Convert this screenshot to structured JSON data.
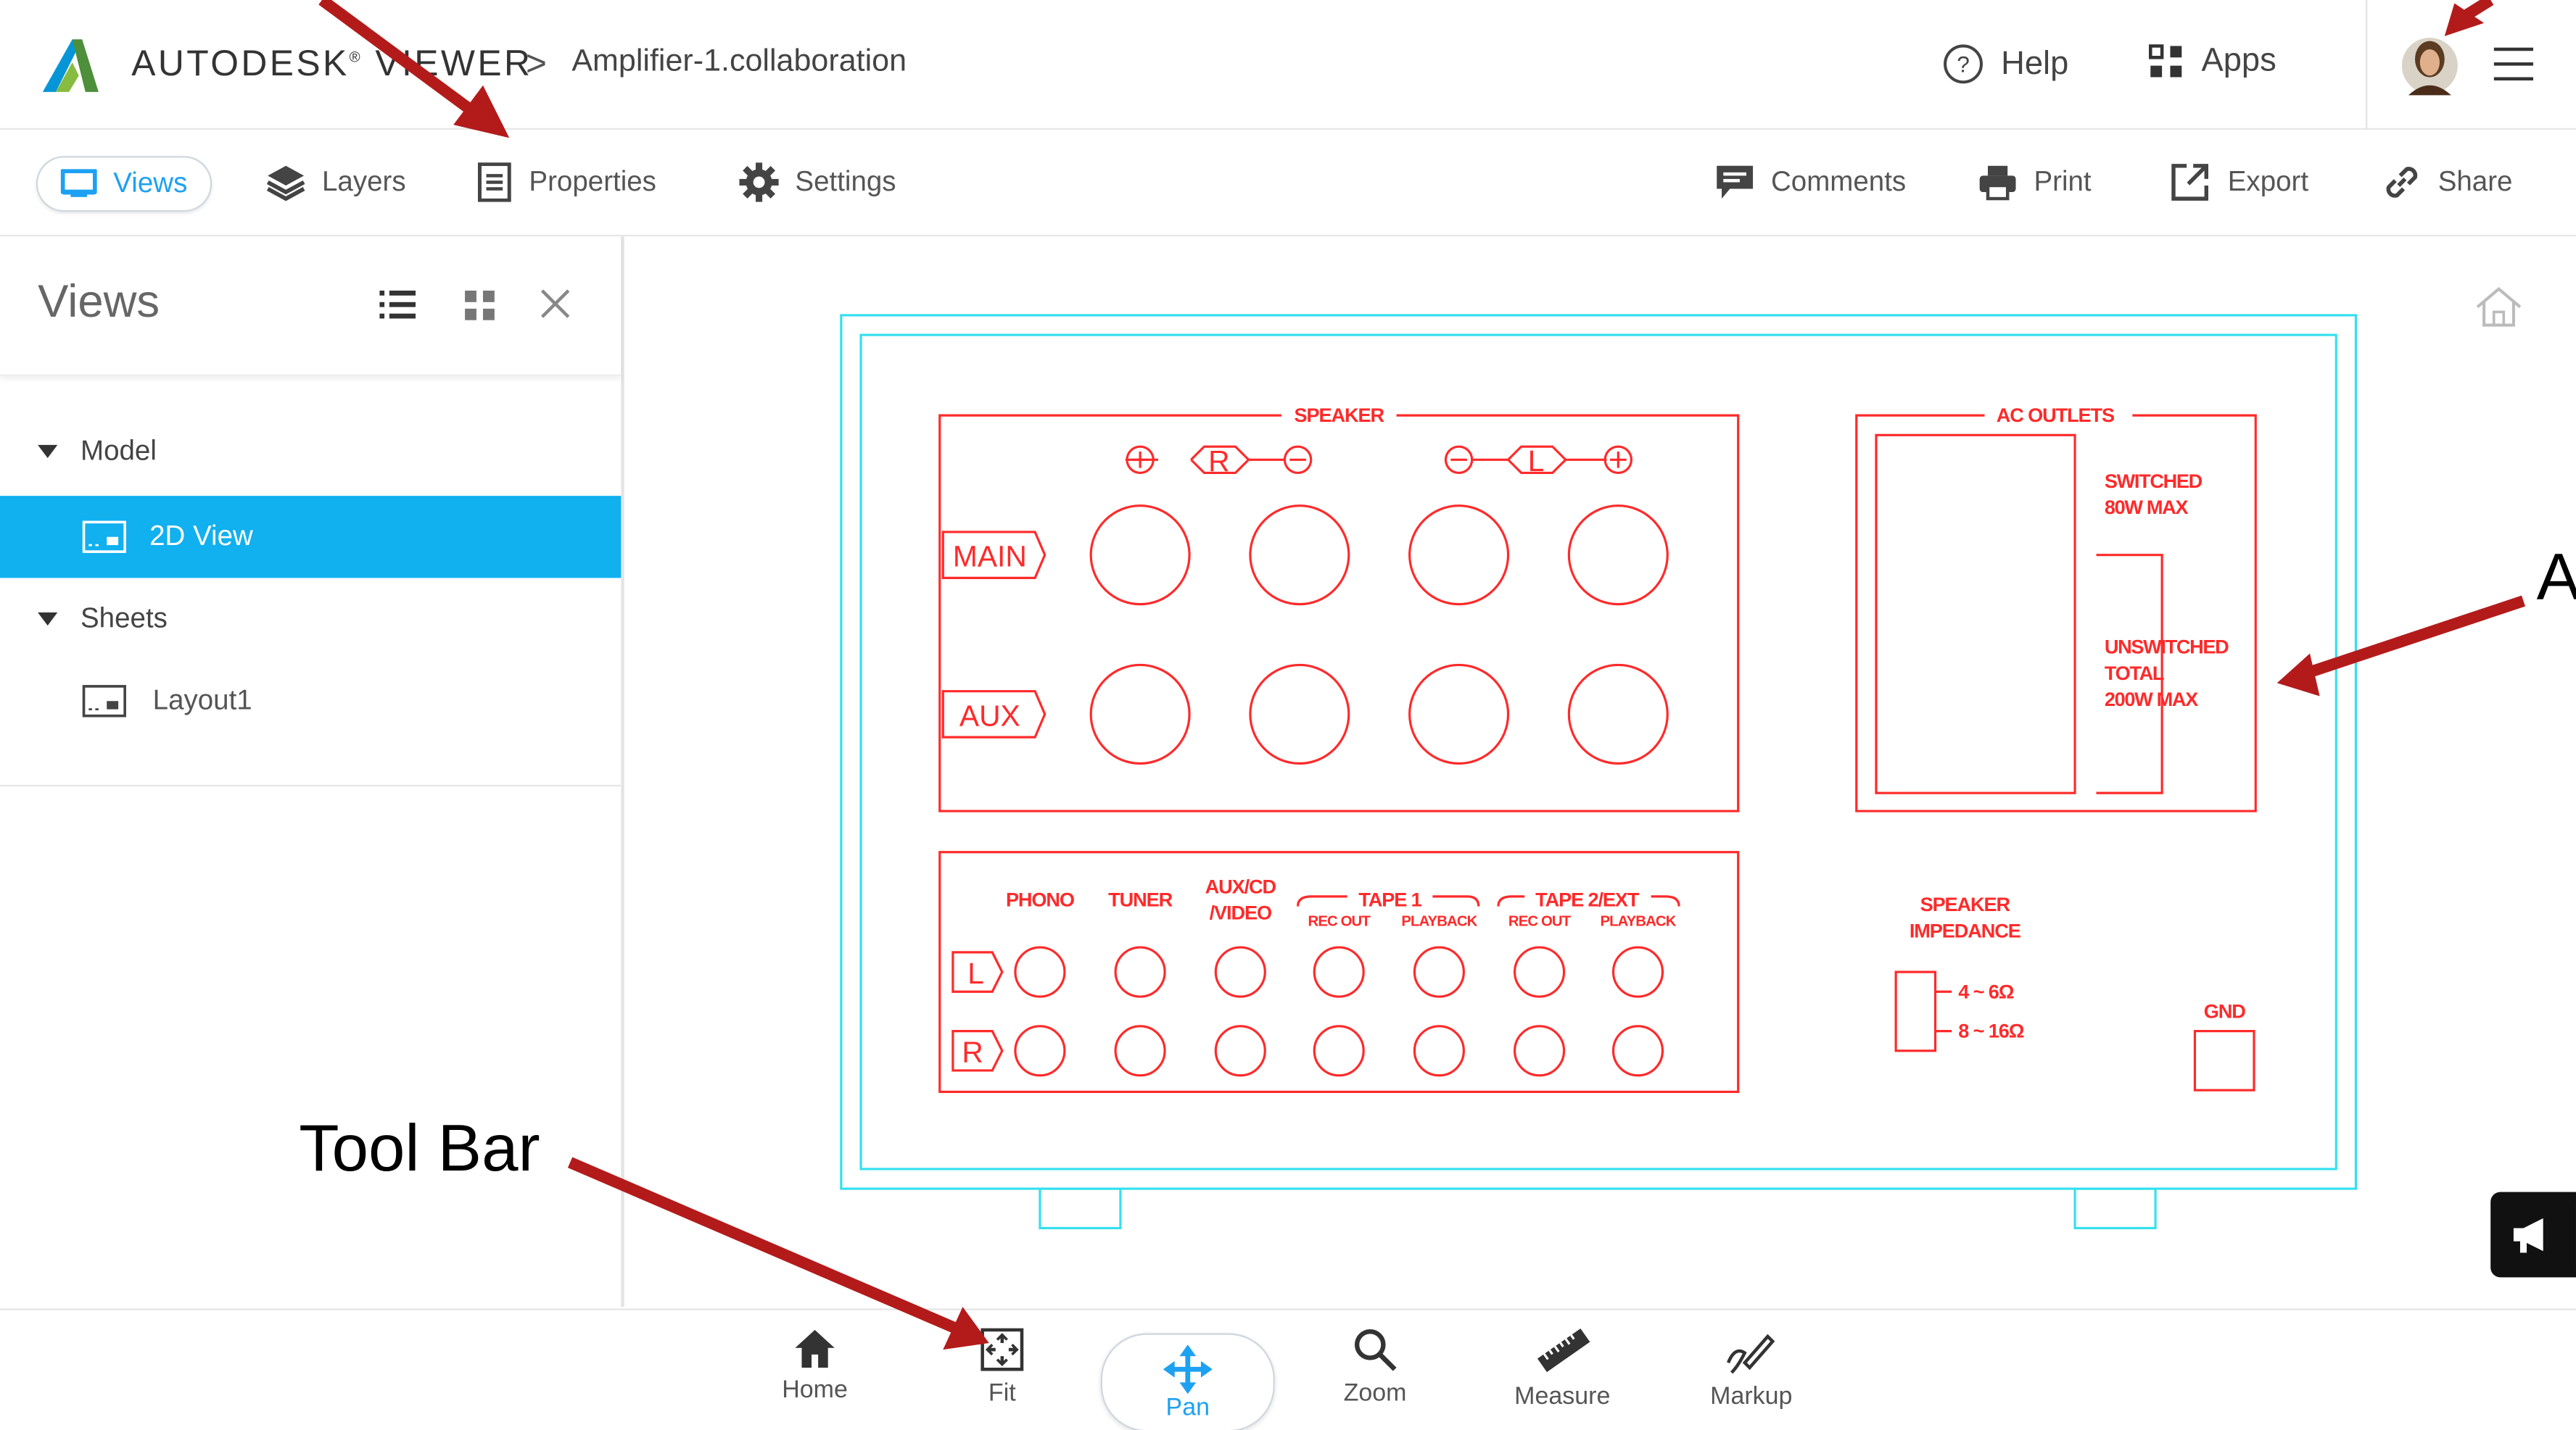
{
  "header": {
    "brand": "AUTODESK",
    "brand_mark": "®",
    "brand_product": "VIEWER",
    "breadcrumb_sep": ">",
    "file_name": "Amplifier-1.collaboration",
    "help_label": "Help",
    "apps_label": "Apps"
  },
  "tabs": {
    "views": "Views",
    "layers": "Layers",
    "properties": "Properties",
    "settings": "Settings",
    "comments": "Comments",
    "print": "Print",
    "export": "Export",
    "share": "Share"
  },
  "panel": {
    "title": "Views",
    "tree": [
      {
        "label": "Model"
      },
      {
        "label": "2D View"
      },
      {
        "label": "Sheets"
      },
      {
        "label": "Layout1"
      }
    ]
  },
  "drawing": {
    "speaker": "SPEAKER",
    "r": "R",
    "l": "L",
    "main": "MAIN",
    "aux": "AUX",
    "ac_outlets": "AC OUTLETS",
    "switched_1": "SWITCHED",
    "switched_2": "80W MAX",
    "unswitched_1": "UNSWITCHED",
    "unswitched_2": "TOTAL",
    "unswitched_3": "200W MAX",
    "phono": "PHONO",
    "tuner": "TUNER",
    "auxcd_1": "AUX/CD",
    "auxcd_2": "/VIDEO",
    "tape1": "TAPE 1",
    "tape2": "TAPE 2/EXT",
    "rec_out": "REC OUT",
    "playback": "PLAYBACK",
    "imp_1": "SPEAKER",
    "imp_2": "IMPEDANCE",
    "imp_a": "4 ~ 6Ω",
    "imp_b": "8 ~ 16Ω",
    "gnd": "GND"
  },
  "toolbar": {
    "home": "Home",
    "fit": "Fit",
    "pan": "Pan",
    "zoom": "Zoom",
    "measure": "Measure",
    "markup": "Markup"
  },
  "annotations": {
    "toolbar_label": "Tool Bar",
    "right_letter": "A"
  },
  "colors": {
    "accent": "#1da1f2",
    "selection": "#11b0ef",
    "drawing_red": "#ff2a2a",
    "drawing_cyan": "#33e0ef",
    "arrow": "#b31b1b"
  }
}
